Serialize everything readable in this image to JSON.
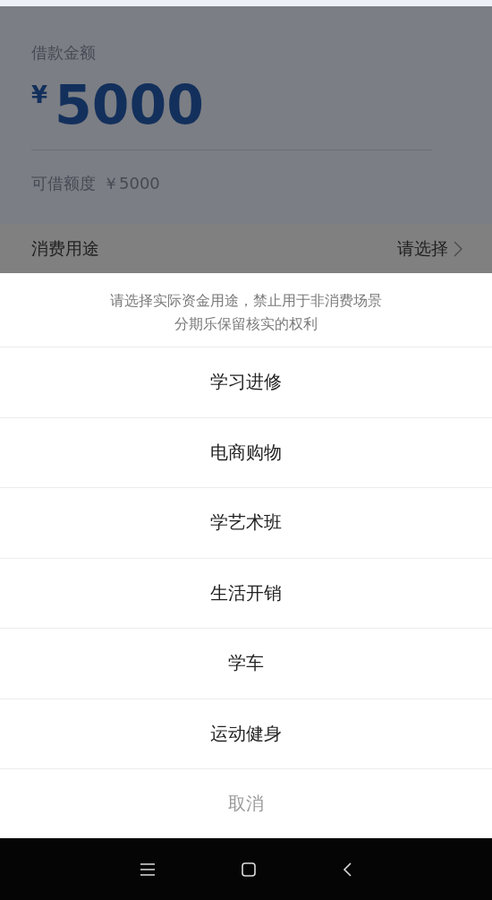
{
  "loan": {
    "label": "借款金额",
    "currency": "¥",
    "amount": "5000",
    "available_label": "可借额度",
    "available_value": "￥5000"
  },
  "purpose": {
    "label": "消费用途",
    "value": "请选择"
  },
  "sheet": {
    "notice": [
      "请选择实际资金用途，禁止用于非消费场景",
      "分期乐保留核实的权利"
    ],
    "options": [
      "学习进修",
      "电商购物",
      "学艺术班",
      "生活开销",
      "学车",
      "运动健身"
    ],
    "cancel": "取消"
  }
}
